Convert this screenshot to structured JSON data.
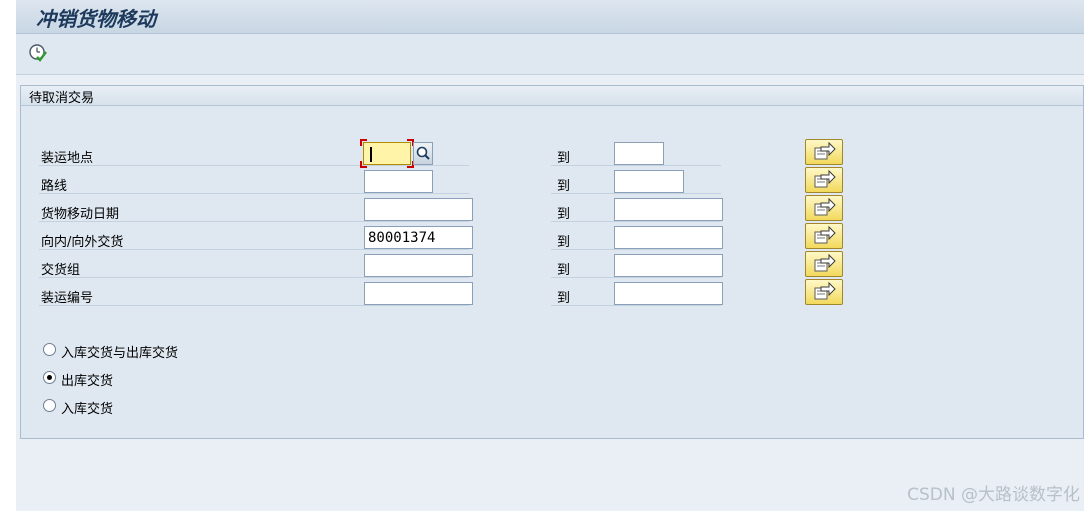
{
  "window": {
    "title": "冲销货物移动"
  },
  "toolbar": {
    "execute_icon": "clock-check-icon"
  },
  "group": {
    "title": "待取消交易",
    "to_label": "到",
    "rows": [
      {
        "label": "装运地点",
        "from": "",
        "to": ""
      },
      {
        "label": "路线",
        "from": "",
        "to": ""
      },
      {
        "label": "货物移动日期",
        "from": "",
        "to": ""
      },
      {
        "label": "向内/向外交货",
        "from": "80001374",
        "to": ""
      },
      {
        "label": "交货组",
        "from": "",
        "to": ""
      },
      {
        "label": "装运编号",
        "from": "",
        "to": ""
      }
    ],
    "radios": [
      {
        "label": "入库交货与出库交货",
        "selected": false
      },
      {
        "label": "出库交货",
        "selected": true
      },
      {
        "label": "入库交货",
        "selected": false
      }
    ]
  },
  "colors": {
    "focus_field": "#fff4a8",
    "multi_button": "#f2d95c"
  },
  "watermark": "CSDN @大路谈数字化"
}
